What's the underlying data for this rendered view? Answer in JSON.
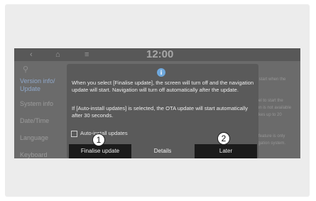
{
  "topbar": {
    "back_icon": "‹",
    "home_icon": "⌂",
    "menu_icon": "≡",
    "clock": "12:00"
  },
  "sidebar": {
    "search_icon": "⚲",
    "items": [
      {
        "label": "Version info/ Update"
      },
      {
        "label": "System info"
      },
      {
        "label": "Date/Time"
      },
      {
        "label": "Language"
      },
      {
        "label": "Keyboard"
      }
    ]
  },
  "background_text": [
    "ill start when the",
    "atel to start the",
    "tion is not available",
    "takes up to 20",
    "d feature is only",
    "vigation system."
  ],
  "dialog": {
    "message1": "When you select [Finalise update], the screen will turn off and the navigation update will start. Navigation will turn off automatically after the update.",
    "message2": "If [Auto-install updates] is selected, the OTA update will start automatically after 30 seconds.",
    "checkbox_label": "Auto-install updates",
    "buttons": {
      "finalise": "Finalise update",
      "details": "Details",
      "later": "Later"
    }
  },
  "callouts": [
    "1",
    "2"
  ]
}
